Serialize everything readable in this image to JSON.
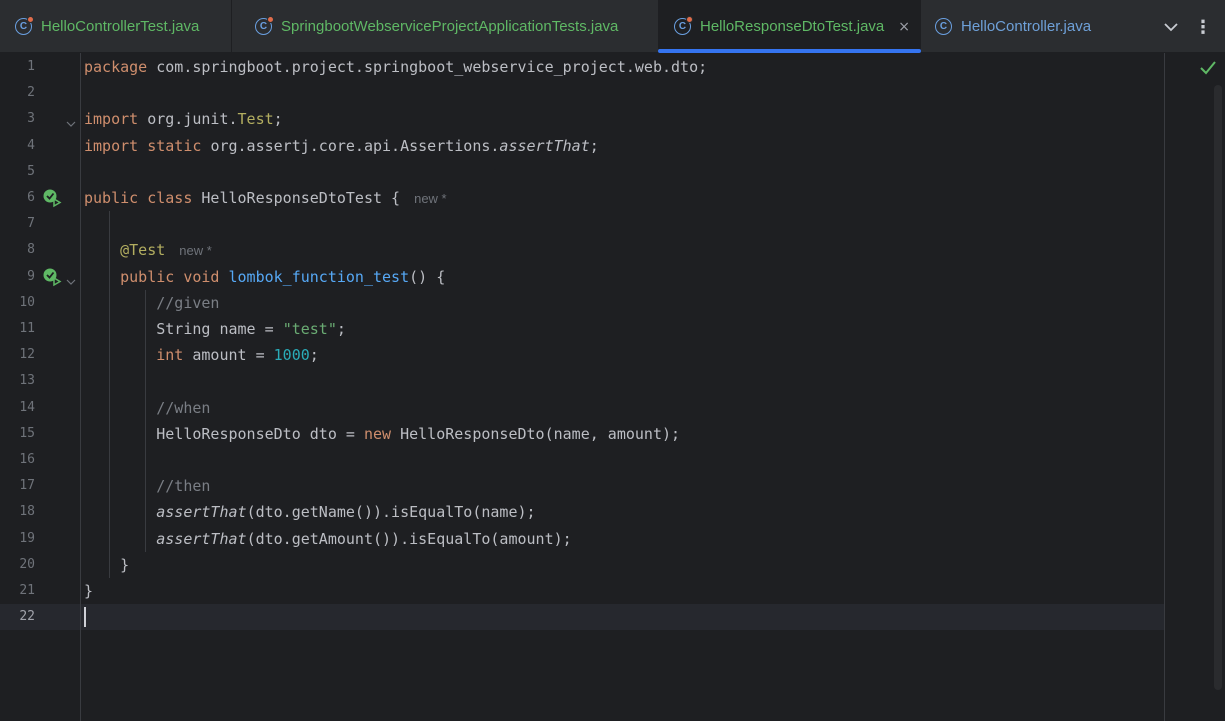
{
  "tabs": [
    {
      "label": "HelloControllerTest.java",
      "active": false,
      "test": true
    },
    {
      "label": "SpringbootWebserviceProjectApplicationTests.java",
      "active": false,
      "test": true
    },
    {
      "label": "HelloResponseDtoTest.java",
      "active": true,
      "test": true
    },
    {
      "label": "HelloController.java",
      "active": false,
      "test": false
    }
  ],
  "tab_icon_glyph": "C",
  "tab_close_glyph": "×",
  "tab_menu_glyph": "⌄",
  "more_glyph": "⋮",
  "editor": {
    "line_numbers": [
      "1",
      "2",
      "3",
      "4",
      "5",
      "6",
      "7",
      "8",
      "9",
      "10",
      "11",
      "12",
      "13",
      "14",
      "15",
      "16",
      "17",
      "18",
      "19",
      "20",
      "21",
      "22"
    ],
    "current_line": "22",
    "lines": [
      {
        "segs": [
          [
            "kw",
            "package "
          ],
          [
            "",
            "com.springboot.project.springboot_webservice_project.web.dto;"
          ]
        ]
      },
      {
        "segs": []
      },
      {
        "segs": [
          [
            "kw",
            "import "
          ],
          [
            "",
            "org.junit."
          ],
          [
            "ann",
            "Test"
          ],
          [
            "",
            ";"
          ]
        ]
      },
      {
        "segs": [
          [
            "kw",
            "import static "
          ],
          [
            "",
            "org.assertj.core.api.Assertions."
          ],
          [
            "it",
            "assertThat"
          ],
          [
            "",
            ";"
          ]
        ]
      },
      {
        "segs": []
      },
      {
        "segs": [
          [
            "kw",
            "public class "
          ],
          [
            "",
            "HelloResponseDtoTest {"
          ],
          [
            "hint",
            "new *"
          ]
        ]
      },
      {
        "segs": []
      },
      {
        "segs": [
          [
            "",
            "    "
          ],
          [
            "ann",
            "@Test"
          ],
          [
            "hint",
            "new *"
          ]
        ]
      },
      {
        "segs": [
          [
            "",
            "    "
          ],
          [
            "kw",
            "public void "
          ],
          [
            "fn",
            "lombok_function_test"
          ],
          [
            "",
            "() {"
          ]
        ]
      },
      {
        "segs": [
          [
            "",
            "        "
          ],
          [
            "cm",
            "//given"
          ]
        ]
      },
      {
        "segs": [
          [
            "",
            "        String name = "
          ],
          [
            "str",
            "\"test\""
          ],
          [
            "",
            ";"
          ]
        ]
      },
      {
        "segs": [
          [
            "",
            "        "
          ],
          [
            "kw",
            "int "
          ],
          [
            "",
            "amount = "
          ],
          [
            "num",
            "1000"
          ],
          [
            "",
            ";"
          ]
        ]
      },
      {
        "segs": []
      },
      {
        "segs": [
          [
            "",
            "        "
          ],
          [
            "cm",
            "//when"
          ]
        ]
      },
      {
        "segs": [
          [
            "",
            "        HelloResponseDto dto = "
          ],
          [
            "kw",
            "new "
          ],
          [
            "",
            "HelloResponseDto(name, amount);"
          ]
        ]
      },
      {
        "segs": []
      },
      {
        "segs": [
          [
            "",
            "        "
          ],
          [
            "cm",
            "//then"
          ]
        ]
      },
      {
        "segs": [
          [
            "",
            "        "
          ],
          [
            "it",
            "assertThat"
          ],
          [
            "",
            "(dto.getName()).isEqualTo(name);"
          ]
        ]
      },
      {
        "segs": [
          [
            "",
            "        "
          ],
          [
            "it",
            "assertThat"
          ],
          [
            "",
            "(dto.getAmount()).isEqualTo(amount);"
          ]
        ]
      },
      {
        "segs": [
          [
            "",
            "    }"
          ]
        ]
      },
      {
        "segs": [
          [
            "",
            "}"
          ]
        ]
      },
      {
        "segs": []
      }
    ],
    "gutter_markers": {
      "run": [
        "6",
        "9"
      ],
      "fold": [
        "3",
        "9"
      ]
    },
    "inspection_status": "ok"
  },
  "colors": {
    "background": "#1e1f22",
    "tabbar": "#2b2d30",
    "active_tab_underline": "#3574f0",
    "test_file_label": "#5fb865",
    "keyword": "#cf8e6d",
    "annotation": "#b3ae60",
    "string": "#6aab73",
    "number": "#2aacb8",
    "method_decl": "#56a8f5",
    "comment": "#7a7e85",
    "run_icon": "#5fb865"
  },
  "icons": {
    "tab_icon": "java-class-icon",
    "run": "run-test-icon",
    "fold": "fold-chevron-icon",
    "inspection": "checkmark-icon"
  }
}
